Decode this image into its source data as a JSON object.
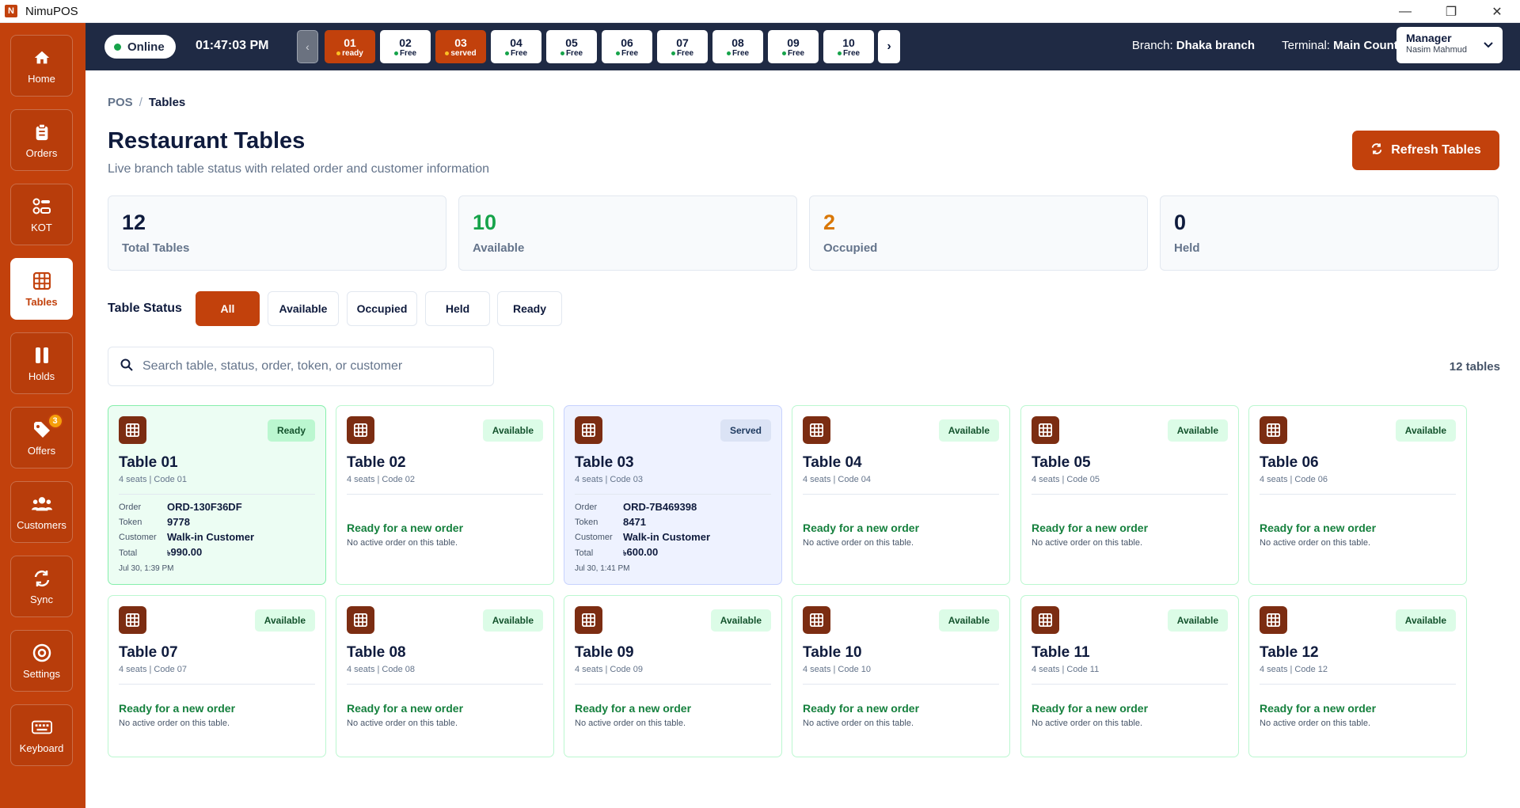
{
  "window": {
    "logo_letter": "N",
    "title": "NimuPOS",
    "minimize": "—",
    "restore": "❐",
    "close": "✕"
  },
  "sidebar": {
    "items": [
      {
        "label": "Home",
        "icon": "home-icon"
      },
      {
        "label": "Orders",
        "icon": "clipboard-icon"
      },
      {
        "label": "KOT",
        "icon": "kot-icon"
      },
      {
        "label": "Tables",
        "icon": "grid-icon",
        "active": true
      },
      {
        "label": "Holds",
        "icon": "pause-icon"
      },
      {
        "label": "Offers",
        "icon": "tag-icon",
        "badge": "3"
      },
      {
        "label": "Customers",
        "icon": "users-icon"
      },
      {
        "label": "Sync",
        "icon": "sync-icon"
      },
      {
        "label": "Settings",
        "icon": "settings-icon"
      },
      {
        "label": "Keyboard",
        "icon": "keyboard-icon"
      }
    ]
  },
  "topbar": {
    "status": "Online",
    "clock": "01:47:03 PM",
    "tabs": [
      {
        "num": "01",
        "status": "ready"
      },
      {
        "num": "02",
        "status": "Free"
      },
      {
        "num": "03",
        "status": "served"
      },
      {
        "num": "04",
        "status": "Free"
      },
      {
        "num": "05",
        "status": "Free"
      },
      {
        "num": "06",
        "status": "Free"
      },
      {
        "num": "07",
        "status": "Free"
      },
      {
        "num": "08",
        "status": "Free"
      },
      {
        "num": "09",
        "status": "Free"
      },
      {
        "num": "10",
        "status": "Free"
      }
    ],
    "branch_label": "Branch:",
    "branch_value": "Dhaka branch",
    "terminal_label": "Terminal:",
    "terminal_value": "Main Counter",
    "user_role": "Manager",
    "user_name": "Nasim Mahmud"
  },
  "breadcrumb": {
    "root": "POS",
    "sep": "/",
    "current": "Tables"
  },
  "header": {
    "title": "Restaurant Tables",
    "subtitle": "Live branch table status with related order and customer information",
    "refresh_label": "Refresh Tables"
  },
  "stats": [
    {
      "value": "12",
      "label": "Total Tables",
      "color": "#0f1b3d"
    },
    {
      "value": "10",
      "label": "Available",
      "color": "#16a34a"
    },
    {
      "value": "2",
      "label": "Occupied",
      "color": "#d97706"
    },
    {
      "value": "0",
      "label": "Held",
      "color": "#0f1b3d"
    }
  ],
  "filters": {
    "label": "Table Status",
    "options": [
      "All",
      "Available",
      "Occupied",
      "Held",
      "Ready"
    ],
    "selected": "All"
  },
  "search": {
    "placeholder": "Search table, status, order, token, or customer",
    "value": ""
  },
  "count_label": "12 tables",
  "labels": {
    "order": "Order",
    "token": "Token",
    "customer": "Customer",
    "total": "Total",
    "free_title": "Ready for a new order",
    "free_sub": "No active order on this table."
  },
  "tables": [
    {
      "name": "Table 01",
      "meta": "4 seats | Code 01",
      "badge": "Ready",
      "state": "ready",
      "order": "ORD-130F36DF",
      "token": "9778",
      "customer": "Walk-in Customer",
      "currency": "৳",
      "total": "990.00",
      "time": "Jul 30, 1:39 PM"
    },
    {
      "name": "Table 02",
      "meta": "4 seats | Code 02",
      "badge": "Available",
      "state": "free"
    },
    {
      "name": "Table 03",
      "meta": "4 seats | Code 03",
      "badge": "Served",
      "state": "served",
      "order": "ORD-7B469398",
      "token": "8471",
      "customer": "Walk-in Customer",
      "currency": "৳",
      "total": "600.00",
      "time": "Jul 30, 1:41 PM"
    },
    {
      "name": "Table 04",
      "meta": "4 seats | Code 04",
      "badge": "Available",
      "state": "free"
    },
    {
      "name": "Table 05",
      "meta": "4 seats | Code 05",
      "badge": "Available",
      "state": "free"
    },
    {
      "name": "Table 06",
      "meta": "4 seats | Code 06",
      "badge": "Available",
      "state": "free"
    },
    {
      "name": "Table 07",
      "meta": "4 seats | Code 07",
      "badge": "Available",
      "state": "free"
    },
    {
      "name": "Table 08",
      "meta": "4 seats | Code 08",
      "badge": "Available",
      "state": "free"
    },
    {
      "name": "Table 09",
      "meta": "4 seats | Code 09",
      "badge": "Available",
      "state": "free"
    },
    {
      "name": "Table 10",
      "meta": "4 seats | Code 10",
      "badge": "Available",
      "state": "free"
    },
    {
      "name": "Table 11",
      "meta": "4 seats | Code 11",
      "badge": "Available",
      "state": "free"
    },
    {
      "name": "Table 12",
      "meta": "4 seats | Code 12",
      "badge": "Available",
      "state": "free"
    }
  ],
  "colors": {
    "brand": "#c2410c",
    "nav": "#1f2a44",
    "success": "#16a34a",
    "warning": "#d97706"
  }
}
